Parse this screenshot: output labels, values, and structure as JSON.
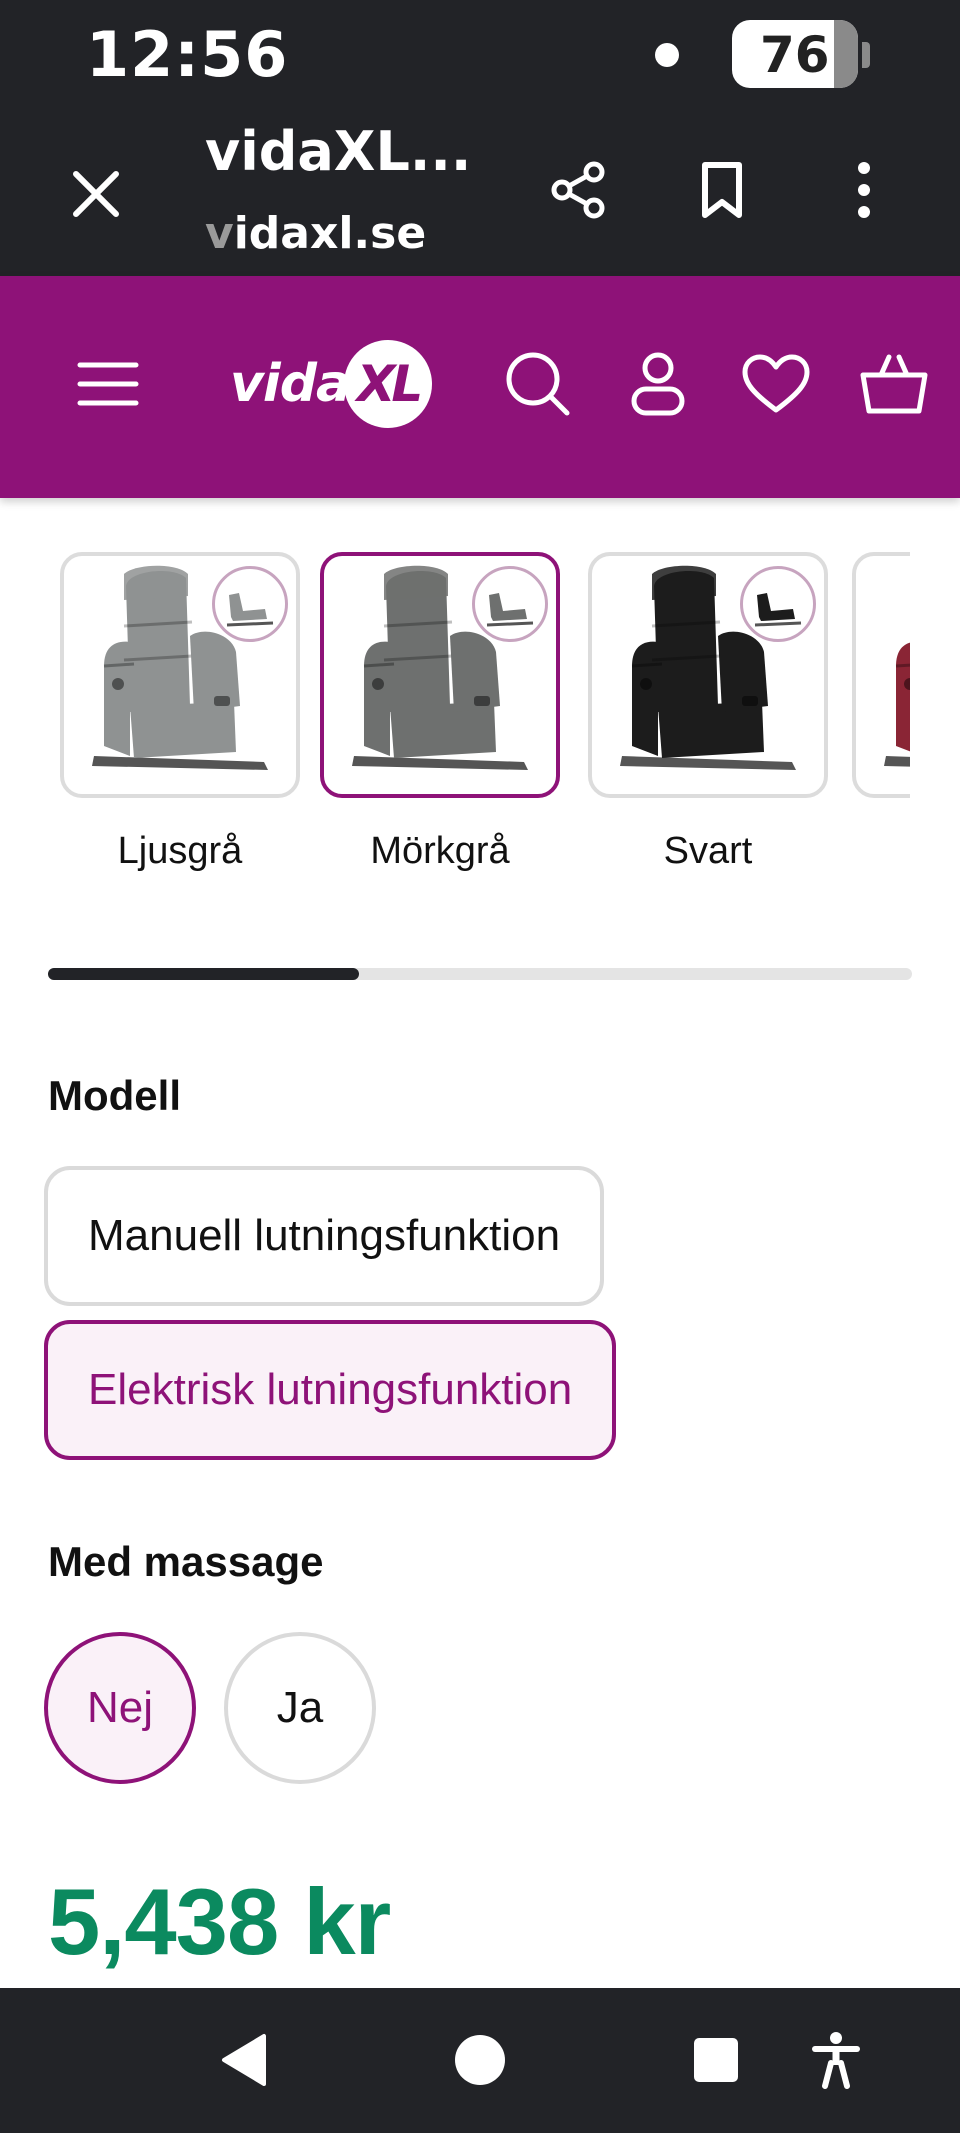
{
  "status_bar": {
    "time": "12:56",
    "battery": "76"
  },
  "browser": {
    "title": "vidaXL...",
    "domain_faded": "v",
    "domain": "idaxl.se"
  },
  "site": {
    "brand_text": "vida",
    "brand_badge": "XL",
    "accent_color": "#8e1278",
    "header_icons": [
      "menu-icon",
      "search-icon",
      "account-icon",
      "heart-icon",
      "basket-icon"
    ]
  },
  "colors": {
    "swatches": [
      {
        "label": "Ljusgrå",
        "color": "#8f9292",
        "selected": false
      },
      {
        "label": "Mörkgrå",
        "color": "#6e706f",
        "selected": true
      },
      {
        "label": "Svart",
        "color": "#1c1c1c",
        "selected": false
      },
      {
        "label": "",
        "color": "#8a2535",
        "selected": false
      }
    ],
    "scroll_progress": 0.36
  },
  "model": {
    "title": "Modell",
    "options": [
      {
        "label": "Manuell lutningsfunktion",
        "selected": false
      },
      {
        "label": "Elektrisk lutningsfunktion",
        "selected": true
      }
    ]
  },
  "massage": {
    "title": "Med massage",
    "options": [
      {
        "label": "Nej",
        "selected": true
      },
      {
        "label": "Ja",
        "selected": false
      }
    ]
  },
  "price": "5,438 kr",
  "price_color": "#0b8a5f",
  "nav": [
    "back-icon",
    "home-icon",
    "recents-icon",
    "accessibility-icon"
  ]
}
